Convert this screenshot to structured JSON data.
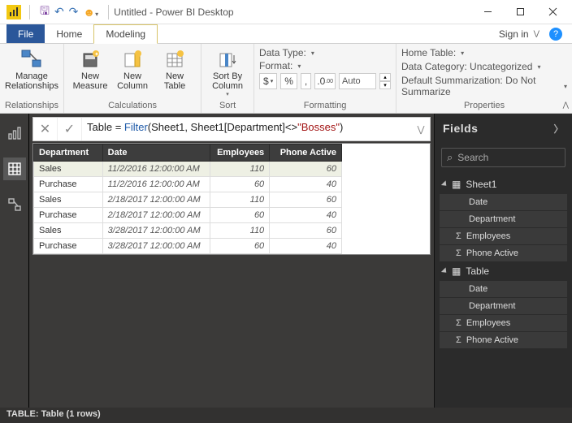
{
  "titlebar": {
    "title": "Untitled - Power BI Desktop"
  },
  "tabs": {
    "file": "File",
    "home": "Home",
    "modeling": "Modeling",
    "signin": "Sign in"
  },
  "ribbon": {
    "relationships": {
      "manage": "Manage\nRelationships",
      "group": "Relationships"
    },
    "calculations": {
      "newMeasure": "New\nMeasure",
      "newColumn": "New\nColumn",
      "newTable": "New\nTable",
      "group": "Calculations"
    },
    "sort": {
      "sortBy": "Sort By\nColumn",
      "group": "Sort"
    },
    "formatting": {
      "dataType": "Data Type:",
      "format": "Format:",
      "auto": "Auto",
      "group": "Formatting",
      "dollar": "$",
      "percent": "%",
      "comma": ","
    },
    "properties": {
      "homeTable": "Home Table:",
      "dataCategory": "Data Category: Uncategorized",
      "defaultSum": "Default Summarization: Do Not Summarize",
      "group": "Properties"
    }
  },
  "formula": {
    "tableName": "Table",
    "eq": " = ",
    "fn": "Filter",
    "args1": "(Sheet1, Sheet1[Department]<>",
    "str": "\"Bosses\"",
    "args2": ")"
  },
  "grid": {
    "cols": [
      "Department",
      "Date",
      "Employees",
      "Phone Active"
    ],
    "rows": [
      [
        "Sales",
        "11/2/2016 12:00:00 AM",
        "110",
        "60"
      ],
      [
        "Purchase",
        "11/2/2016 12:00:00 AM",
        "60",
        "40"
      ],
      [
        "Sales",
        "2/18/2017 12:00:00 AM",
        "110",
        "60"
      ],
      [
        "Purchase",
        "2/18/2017 12:00:00 AM",
        "60",
        "40"
      ],
      [
        "Sales",
        "3/28/2017 12:00:00 AM",
        "110",
        "60"
      ],
      [
        "Purchase",
        "3/28/2017 12:00:00 AM",
        "60",
        "40"
      ]
    ]
  },
  "fields": {
    "title": "Fields",
    "search": "Search",
    "tables": [
      {
        "name": "Sheet1",
        "fields": [
          "Date",
          "Department",
          "Employees",
          "Phone Active"
        ],
        "sigma": [
          false,
          false,
          true,
          true
        ]
      },
      {
        "name": "Table",
        "fields": [
          "Date",
          "Department",
          "Employees",
          "Phone Active"
        ],
        "sigma": [
          false,
          false,
          true,
          true
        ]
      }
    ]
  },
  "status": "TABLE: Table (1 rows)"
}
